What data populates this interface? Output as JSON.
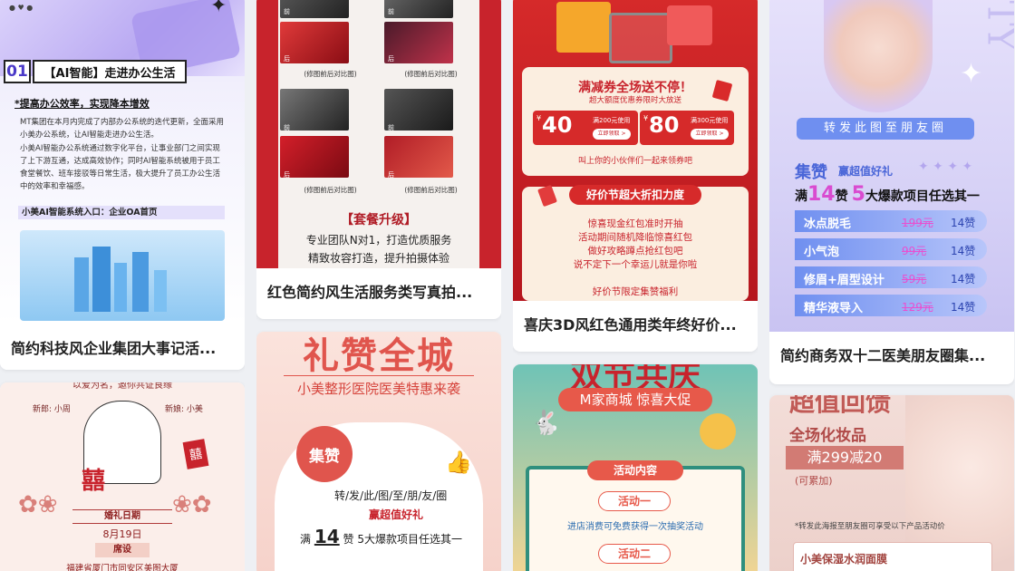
{
  "cards": [
    {
      "title": "简约科技风企业集团大事记活...",
      "poster": {
        "num": "01",
        "heading": "【AI智能】走进办公生活",
        "sub": "*提高办公效率，实现降本增效",
        "para1": "MT集团在本月内完成了内部办公系统的迭代更新，全面采用小美办公系统，让AI智能走进办公生活。",
        "para2": "小美AI智能办公系统通过数字化平台，让事业部门之间实现了上下游互通，达成高效协作；同时AI智能系统被用于员工食堂餐饮、班车接驳等日常生活，极大提升了员工办公生活中的效率和幸福感。",
        "entry": "小美AI智能系统入口：企业OA首页"
      }
    },
    {
      "title": "红色简约风生活服务类写真拍...",
      "poster": {
        "tag_before": "前",
        "tag_after": "后",
        "caption": "(修图前后对比图)",
        "upgrade": "【套餐升级】",
        "line1": "专业团队N对1，打造优质服务",
        "line2": "精致妆容打造，提升拍摄体验"
      }
    },
    {
      "title": "喜庆3D风红色通用类年终好价...",
      "poster": {
        "headline": "满减券全场送不停！",
        "sub": "超大额度优惠券限时大放送",
        "coupon1_value": "40",
        "coupon1_text": "满200元使用",
        "coupon2_value": "80",
        "coupon2_text": "满300元使用",
        "coupon_btn": "立即领取 >",
        "currency": "¥",
        "invite": "叫上你的小伙伴们一起来领券吧",
        "banner": "好价节超大折扣力度",
        "lines": [
          "惊喜现金红包准时开抽",
          "活动期间随机降临惊喜红包",
          "做好攻略蹲点抢红包吧",
          "说不定下一个幸运儿就是你啦"
        ],
        "footer": "好价节限定集赞福利"
      }
    },
    {
      "title": "简约商务双十二医美朋友圈集...",
      "poster": {
        "letters": "TY",
        "share": "转发此图至朋友圈",
        "collect": "集赞",
        "collect_sub": "赢超值好礼",
        "rule_pre": "满",
        "rule_n1": "14",
        "rule_mid": "赞",
        "rule_n2": "5",
        "rule_post": "大爆款项目任选其一",
        "items": [
          {
            "name": "冰点脱毛",
            "price": "199元",
            "likes": "14赞"
          },
          {
            "name": "小气泡",
            "price": "99元",
            "likes": "14赞"
          },
          {
            "name": "修眉+眉型设计",
            "price": "59元",
            "likes": "14赞"
          },
          {
            "name": "精华液导入",
            "price": "129元",
            "likes": "14赞"
          }
        ]
      }
    },
    {
      "title": "",
      "poster": {
        "banner": "以爱为名，邀你共证良缘",
        "groom": "新郎: 小周",
        "bride": "新娘: 小美",
        "xi": "囍",
        "date_label": "婚礼日期",
        "date": "8月19日",
        "venue_label": "席设",
        "address": "福建省厦门市同安区美图大厦"
      }
    },
    {
      "title": "",
      "poster": {
        "headline": "礼赞全城",
        "sub": "小美整形医院医美特惠来袭",
        "badge": "集赞",
        "share": "转/发/此/图/至/朋/友/圈",
        "gift": "赢超值好礼",
        "rule_pre": "满",
        "rule_n1": "14",
        "rule_post": "赞 5大爆款项目任选其一"
      }
    },
    {
      "title": "",
      "poster": {
        "headline": "双节共庆",
        "sub": "M家商城 惊喜大促",
        "box_title": "活动内容",
        "act1": "活动一",
        "act1_text": "进店消费可免费获得一次抽奖活动",
        "act2": "活动二"
      }
    },
    {
      "title": "",
      "poster": {
        "headline": "超值回馈",
        "sub": "全场化妆品",
        "deal": "满299减20",
        "note": "(可累加)",
        "tip": "*转发此海报至朋友圈可享受以下产品活动价",
        "product": "小美保湿水润面膜"
      }
    }
  ],
  "colors": {
    "red": "#c8232c",
    "deep_red": "#a8121c",
    "purple": "#6f5de6",
    "pink": "#f3c6c0",
    "gold": "#f2c15c"
  }
}
